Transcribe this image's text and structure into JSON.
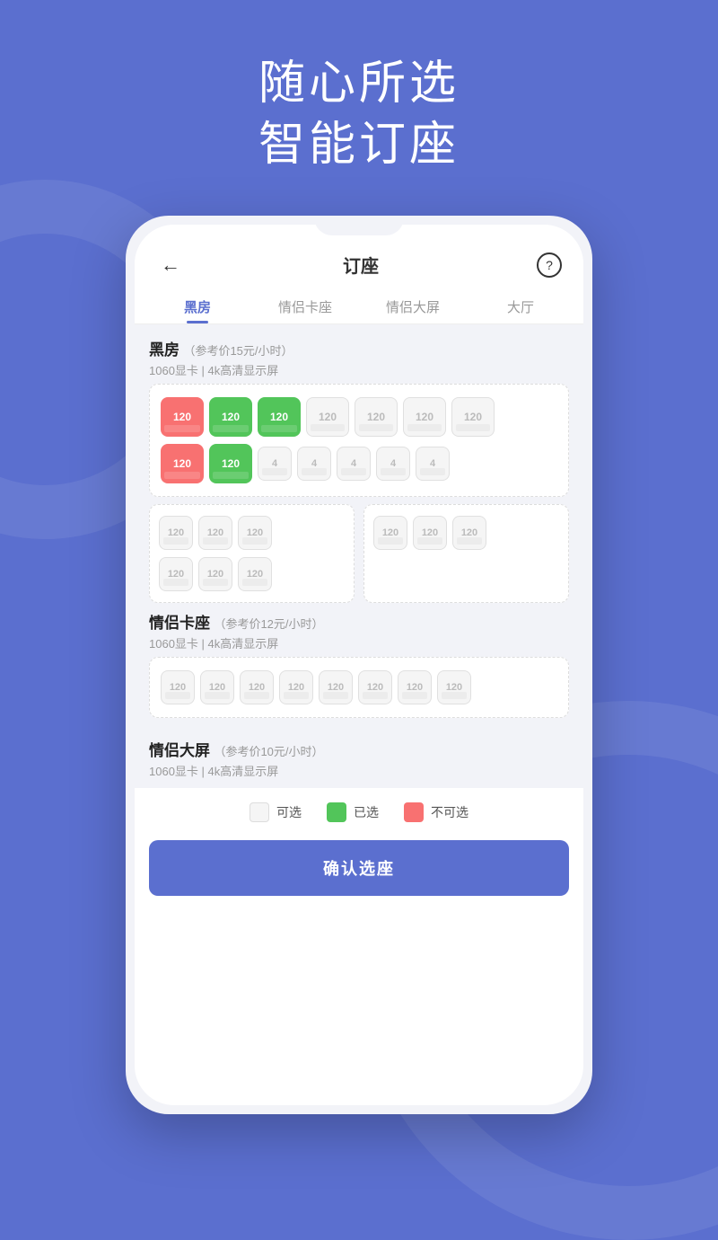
{
  "header": {
    "line1": "随心所选",
    "line2": "智能订座"
  },
  "topbar": {
    "back_icon": "←",
    "title": "订座",
    "help_icon": "?"
  },
  "tabs": [
    {
      "id": "hei",
      "label": "黑房",
      "active": true
    },
    {
      "id": "couple_card",
      "label": "情侣卡座",
      "active": false
    },
    {
      "id": "couple_big",
      "label": "情侣大屏",
      "active": false
    },
    {
      "id": "hall",
      "label": "大厅",
      "active": false
    }
  ],
  "sections": [
    {
      "id": "hei_fang",
      "title": "黑房",
      "price_label": "（参考价15元/小时）",
      "specs": "1060显卡  |  4k高清显示屏",
      "rows_top": [
        [
          {
            "label": "120",
            "state": "unavailable"
          },
          {
            "label": "120",
            "state": "selected"
          },
          {
            "label": "120",
            "state": "selected"
          },
          {
            "label": "120",
            "state": "available"
          },
          {
            "label": "120",
            "state": "available"
          },
          {
            "label": "120",
            "state": "available"
          },
          {
            "label": "120",
            "state": "available"
          }
        ],
        [
          {
            "label": "120",
            "state": "unavailable"
          },
          {
            "label": "120",
            "state": "selected"
          },
          {
            "label": "4",
            "state": "available"
          },
          {
            "label": "4",
            "state": "available"
          },
          {
            "label": "4",
            "state": "available"
          },
          {
            "label": "4",
            "state": "available"
          },
          {
            "label": "4",
            "state": "available"
          }
        ]
      ],
      "grid_left": [
        [
          {
            "label": "120",
            "state": "available"
          },
          {
            "label": "120",
            "state": "available"
          },
          {
            "label": "120",
            "state": "available"
          }
        ],
        [
          {
            "label": "120",
            "state": "available"
          },
          {
            "label": "120",
            "state": "available"
          },
          {
            "label": "120",
            "state": "available"
          }
        ]
      ],
      "grid_right": [
        [
          {
            "label": "120",
            "state": "available"
          },
          {
            "label": "120",
            "state": "available"
          },
          {
            "label": "120",
            "state": "available"
          }
        ]
      ]
    },
    {
      "id": "couple_card_sec",
      "title": "情侣卡座",
      "price_label": "（参考价12元/小时）",
      "specs": "1060显卡  |  4k高清显示屏",
      "rows": [
        [
          {
            "label": "120",
            "state": "available"
          },
          {
            "label": "120",
            "state": "available"
          },
          {
            "label": "120",
            "state": "available"
          },
          {
            "label": "120",
            "state": "available"
          },
          {
            "label": "120",
            "state": "available"
          },
          {
            "label": "120",
            "state": "available"
          },
          {
            "label": "120",
            "state": "available"
          },
          {
            "label": "120",
            "state": "available"
          }
        ]
      ]
    },
    {
      "id": "couple_big_sec",
      "title": "情侣大屏",
      "price_label": "（参考价10元/小时）",
      "specs": "1060显卡  |  4k高清显示屏"
    }
  ],
  "legend": {
    "available_label": "可选",
    "selected_label": "已选",
    "unavailable_label": "不可选"
  },
  "confirm_button_label": "确认选座"
}
